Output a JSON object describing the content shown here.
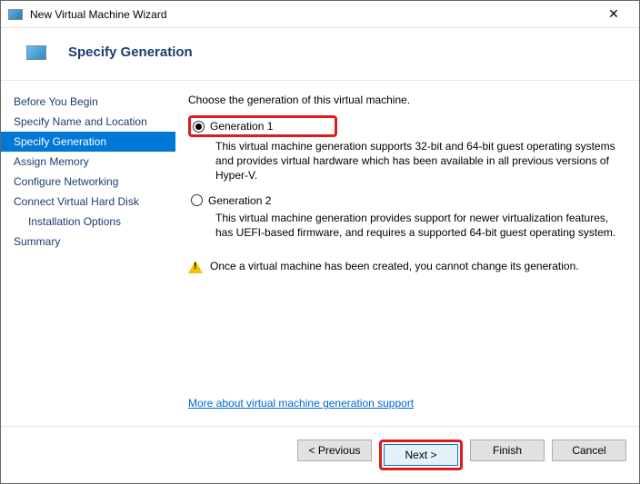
{
  "titlebar": {
    "title": "New Virtual Machine Wizard"
  },
  "header": {
    "title": "Specify Generation"
  },
  "sidebar": {
    "items": [
      {
        "label": "Before You Begin"
      },
      {
        "label": "Specify Name and Location"
      },
      {
        "label": "Specify Generation"
      },
      {
        "label": "Assign Memory"
      },
      {
        "label": "Configure Networking"
      },
      {
        "label": "Connect Virtual Hard Disk"
      },
      {
        "label": "Installation Options"
      },
      {
        "label": "Summary"
      }
    ]
  },
  "main": {
    "prompt": "Choose the generation of this virtual machine.",
    "gen1": {
      "label": "Generation 1",
      "desc": "This virtual machine generation supports 32-bit and 64-bit guest operating systems and provides virtual hardware which has been available in all previous versions of Hyper-V."
    },
    "gen2": {
      "label": "Generation 2",
      "desc": "This virtual machine generation provides support for newer virtualization features, has UEFI-based firmware, and requires a supported 64-bit guest operating system."
    },
    "warning": "Once a virtual machine has been created, you cannot change its generation.",
    "link": "More about virtual machine generation support"
  },
  "footer": {
    "previous": "< Previous",
    "next": "Next >",
    "finish": "Finish",
    "cancel": "Cancel"
  }
}
